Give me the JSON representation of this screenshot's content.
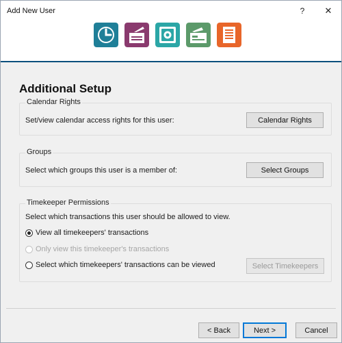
{
  "window": {
    "title": "Add New User",
    "help_glyph": "?",
    "close_glyph": "✕"
  },
  "steps": [
    {
      "icon": "clock-icon",
      "color": "#1f7f98"
    },
    {
      "icon": "card-reader-icon",
      "color": "#8a3a6e"
    },
    {
      "icon": "safe-icon",
      "color": "#2ba6a6"
    },
    {
      "icon": "cash-register-icon",
      "color": "#5c9a6a"
    },
    {
      "icon": "document-icon",
      "color": "#e8662a"
    }
  ],
  "accent_color": "#0b4f7c",
  "heading": "Additional Setup",
  "calendar": {
    "legend": "Calendar Rights",
    "text": "Set/view calendar access rights for this user:",
    "button": "Calendar Rights"
  },
  "groups": {
    "legend": "Groups",
    "text": "Select which groups this user is a member of:",
    "button": "Select Groups"
  },
  "timekeeper": {
    "legend": "Timekeeper Permissions",
    "text": "Select which transactions this user should be allowed to view.",
    "options": [
      {
        "label": "View all timekeepers' transactions",
        "checked": true,
        "enabled": true
      },
      {
        "label": "Only view this timekeeper's transactions",
        "checked": false,
        "enabled": false
      },
      {
        "label": "Select which timekeepers' transactions can be viewed",
        "checked": false,
        "enabled": true
      }
    ],
    "button": "Select Timekeepers",
    "button_enabled": false
  },
  "footer": {
    "back": "< Back",
    "next": "Next >",
    "cancel": "Cancel"
  }
}
